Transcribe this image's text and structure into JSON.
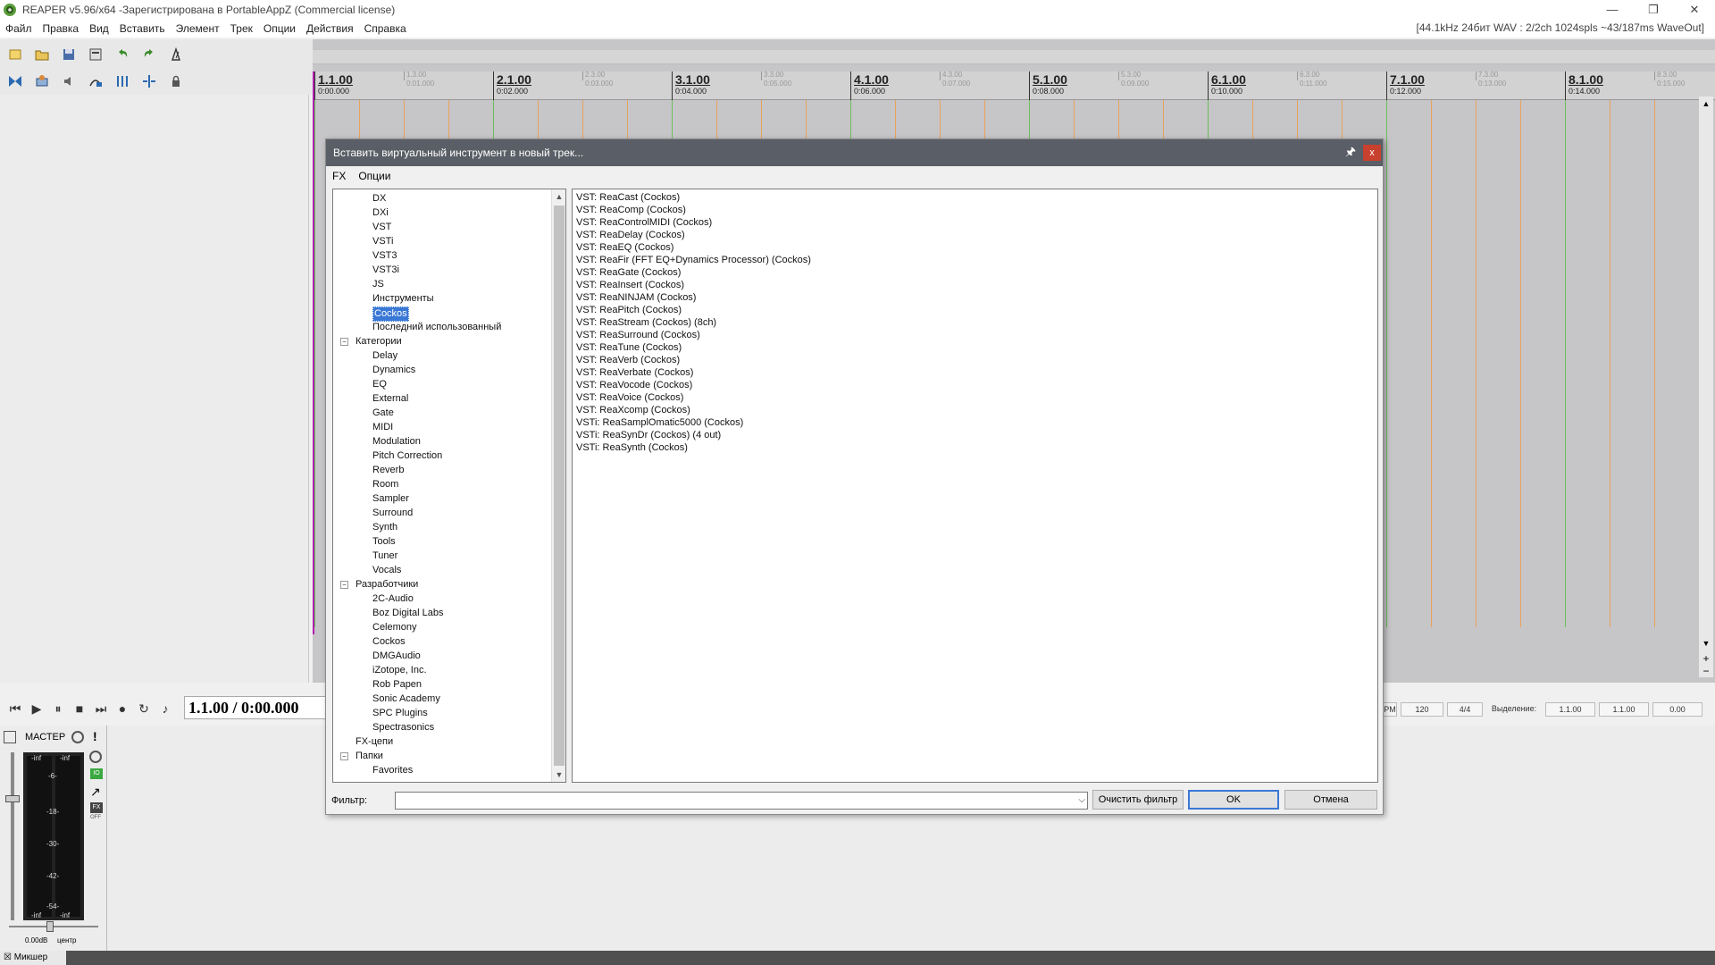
{
  "window": {
    "title": "REAPER v5.96/x64 -Зарегистрирована в PortableAppZ (Commercial license)",
    "status": "[44.1kHz 24бит WAV : 2/2ch 1024spls ~43/187ms WaveOut]",
    "btn_min": "—",
    "btn_max": "❐",
    "btn_close": "✕"
  },
  "menu": [
    "Файл",
    "Правка",
    "Вид",
    "Вставить",
    "Элемент",
    "Трек",
    "Опции",
    "Действия",
    "Справка"
  ],
  "ruler": {
    "major": [
      {
        "bar": "1.1.00",
        "time": "0:00.000"
      },
      {
        "bar": "2.1.00",
        "time": "0:02.000"
      },
      {
        "bar": "3.1.00",
        "time": "0:04.000"
      },
      {
        "bar": "4.1.00",
        "time": "0:06.000"
      },
      {
        "bar": "5.1.00",
        "time": "0:08.000"
      },
      {
        "bar": "6.1.00",
        "time": "0:10.000"
      },
      {
        "bar": "7.1.00",
        "time": "0:12.000"
      },
      {
        "bar": "8.1.00",
        "time": "0:14.000"
      }
    ],
    "minor": [
      {
        "bar": "1.3.00",
        "time": "0:01.000"
      },
      {
        "bar": "2.3.00",
        "time": "0:03.000"
      },
      {
        "bar": "3.3.00",
        "time": "0:05.000"
      },
      {
        "bar": "4.3.00",
        "time": "0:07.000"
      },
      {
        "bar": "5.3.00",
        "time": "0:09.000"
      },
      {
        "bar": "6.3.00",
        "time": "0:11.000"
      },
      {
        "bar": "7.3.00",
        "time": "0:13.000"
      },
      {
        "bar": "8.3.00",
        "time": "0:15.000"
      }
    ]
  },
  "transport": {
    "time": "1.1.00 / 0:00.000",
    "bpm": "120",
    "sig": "4/4",
    "sel_label": "Выделение:",
    "sel_start": "1.1.00",
    "sel_end": "1.1.00",
    "sel_len": "0.00",
    "bpm_tail": "PM"
  },
  "mixer": {
    "master_label": "МАСТЕР",
    "peak_l": "-inf",
    "peak_r": "-inf",
    "scale_top": "-6-",
    "scale_marks": [
      "12",
      "6",
      "0",
      "12",
      "18",
      "24",
      "30",
      "36",
      "42"
    ],
    "center_marks": [
      "-18-",
      "-30-",
      "-42-",
      "-54-"
    ],
    "foot_l": "-inf",
    "foot_r": "-inf",
    "volume": "0.00dB",
    "pan": "центр",
    "tab": "Микшер",
    "btn_io": "IO",
    "btn_fx": "FX",
    "btn_off": "OFF"
  },
  "dialog": {
    "title": "Вставить виртуальный инструмент в новый трек...",
    "pin": "🖈",
    "close": "x",
    "menu": [
      "FX",
      "Опции"
    ],
    "tree": {
      "top_items": [
        "DX",
        "DXi",
        "VST",
        "VSTi",
        "VST3",
        "VST3i",
        "JS",
        "Инструменты",
        "Cockos",
        "Последний использованный"
      ],
      "categories_label": "Категории",
      "categories": [
        "Delay",
        "Dynamics",
        "EQ",
        "External",
        "Gate",
        "MIDI",
        "Modulation",
        "Pitch Correction",
        "Reverb",
        "Room",
        "Sampler",
        "Surround",
        "Synth",
        "Tools",
        "Tuner",
        "Vocals"
      ],
      "developers_label": "Разработчики",
      "developers": [
        "2C-Audio",
        "Boz Digital Labs",
        "Celemony",
        "Cockos",
        "DMGAudio",
        "iZotope, Inc.",
        "Rob Papen",
        "Sonic Academy",
        "SPC Plugins",
        "Spectrasonics"
      ],
      "fxchains_label": "FX-цепи",
      "folders_label": "Папки",
      "folders": [
        "Favorites"
      ],
      "selected": "Cockos",
      "scroll_up": "▲",
      "scroll_down": "▼",
      "expanded_sign": "−"
    },
    "plugins": [
      "VST: ReaCast (Cockos)",
      "VST: ReaComp (Cockos)",
      "VST: ReaControlMIDI (Cockos)",
      "VST: ReaDelay (Cockos)",
      "VST: ReaEQ (Cockos)",
      "VST: ReaFir (FFT EQ+Dynamics Processor) (Cockos)",
      "VST: ReaGate (Cockos)",
      "VST: ReaInsert (Cockos)",
      "VST: ReaNINJAM (Cockos)",
      "VST: ReaPitch (Cockos)",
      "VST: ReaStream (Cockos) (8ch)",
      "VST: ReaSurround (Cockos)",
      "VST: ReaTune (Cockos)",
      "VST: ReaVerb (Cockos)",
      "VST: ReaVerbate (Cockos)",
      "VST: ReaVocode (Cockos)",
      "VST: ReaVoice (Cockos)",
      "VST: ReaXcomp (Cockos)",
      "VSTi: ReaSamplOmatic5000 (Cockos)",
      "VSTi: ReaSynDr (Cockos) (4 out)",
      "VSTi: ReaSynth (Cockos)"
    ],
    "filter_label": "Фильтр:",
    "filter_value": "",
    "filter_dropdown": "⌵",
    "clear_filter": "Очистить фильтр",
    "ok": "OK",
    "cancel": "Отмена"
  },
  "colors": {
    "dialog_title_bg": "#5a5e66",
    "close_red": "#c8402e",
    "selection_blue": "#3a78d6",
    "arrange_bg": "#c6c5c8",
    "gridline_orange": "#e8a35a",
    "gridline_green": "#6bbf5a",
    "cursor": "#b020b0"
  }
}
